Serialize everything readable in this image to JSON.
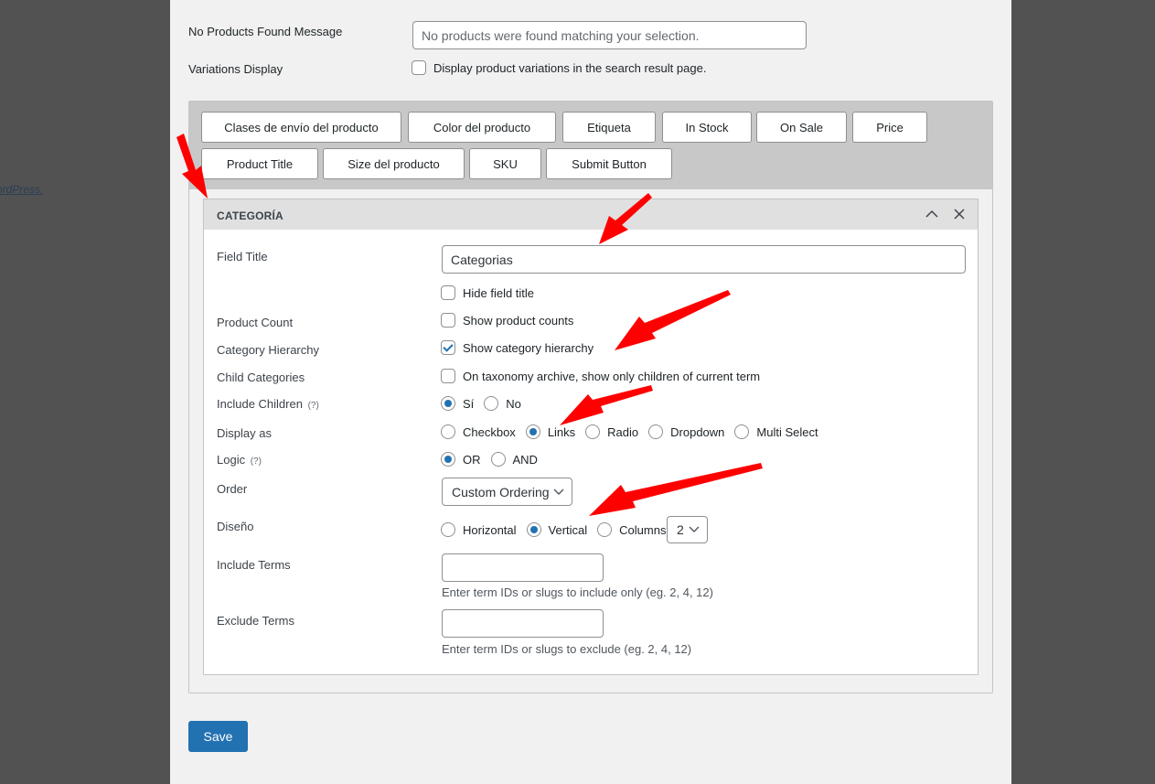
{
  "side_link": "ordPress.",
  "settings": {
    "no_products": {
      "label": "No Products Found Message",
      "placeholder": "No products were found matching your selection."
    },
    "variations": {
      "label": "Variations Display",
      "checkbox_label": "Display product variations in the search result page."
    }
  },
  "field_buttons": [
    "Clases de envío del producto",
    "Color del producto",
    "Etiqueta",
    "In Stock",
    "On Sale",
    "Price",
    "Product Title",
    "Size del producto",
    "SKU",
    "Submit Button"
  ],
  "panel": {
    "title": "CATEGORÍA",
    "help_mark": "(?)",
    "field_title": {
      "label": "Field Title",
      "value": "Categorias"
    },
    "hide_title": {
      "label": "Hide field title",
      "checked": false
    },
    "product_count": {
      "label": "Product Count",
      "option": "Show product counts",
      "checked": false
    },
    "category_hierarchy": {
      "label": "Category Hierarchy",
      "option": "Show category hierarchy",
      "checked": true
    },
    "child_categories": {
      "label": "Child Categories",
      "option": "On taxonomy archive, show only children of current term",
      "checked": false
    },
    "include_children": {
      "label": "Include Children",
      "options": [
        "Sí",
        "No"
      ],
      "selected": "Sí"
    },
    "display_as": {
      "label": "Display as",
      "options": [
        "Checkbox",
        "Links",
        "Radio",
        "Dropdown",
        "Multi Select"
      ],
      "selected": "Links"
    },
    "logic": {
      "label": "Logic",
      "options": [
        "OR",
        "AND"
      ],
      "selected": "OR"
    },
    "order": {
      "label": "Order",
      "value": "Custom Ordering"
    },
    "design": {
      "label": "Diseño",
      "options": [
        "Horizontal",
        "Vertical",
        "Columns"
      ],
      "selected": "Vertical",
      "columns_value": "2"
    },
    "include_terms": {
      "label": "Include Terms",
      "value": "",
      "description": "Enter term IDs or slugs to include only (eg. 2, 4, 12)"
    },
    "exclude_terms": {
      "label": "Exclude Terms",
      "value": "",
      "description": "Enter term IDs or slugs to exclude (eg. 2, 4, 12)"
    }
  },
  "save_label": "Save",
  "colors": {
    "accent": "#2271b1",
    "annotation_arrow": "#ff0000",
    "page_bg": "#f1f1f1",
    "backdrop": "#525252"
  }
}
